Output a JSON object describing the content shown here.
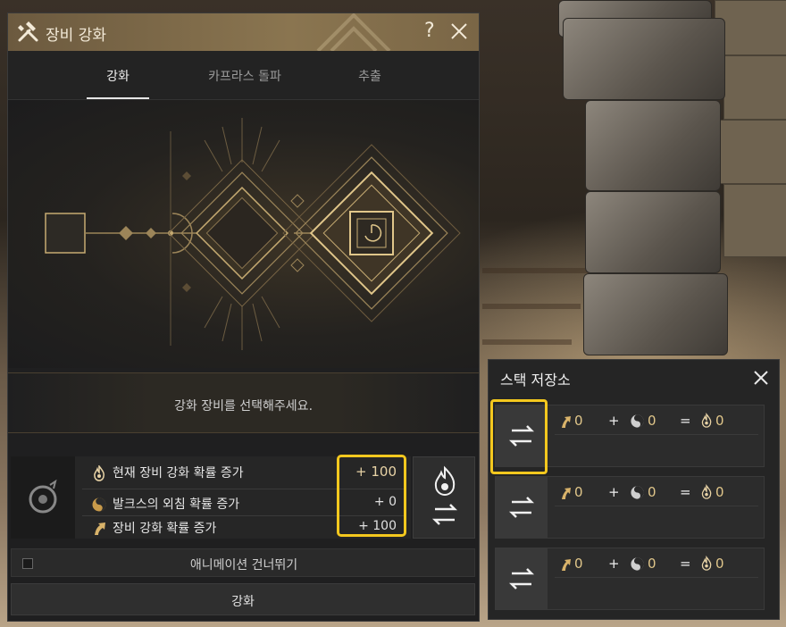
{
  "window": {
    "title": "장비 강화",
    "help_label": "?"
  },
  "tabs": [
    {
      "label": "강화",
      "active": true
    },
    {
      "label": "카프라스 돌파",
      "active": false
    },
    {
      "label": "추출",
      "active": false
    }
  ],
  "stage": {
    "message": "강화 장비를 선택해주세요."
  },
  "rates": {
    "rows": [
      {
        "label": "현재 장비 강화 확률 증가",
        "value": "+ 100",
        "icon": "flame-icon"
      },
      {
        "label": "발크스의 외침 확률 증가",
        "value": "+ 0",
        "icon": "valks-icon"
      },
      {
        "label": "장비 강화 확률 증가",
        "value": "+ 100",
        "icon": "arrow-up-icon"
      }
    ]
  },
  "options": {
    "skip_animation_label": "애니메이션 건너뛰기",
    "skip_animation_checked": false
  },
  "actions": {
    "enhance_label": "강화"
  },
  "stack_storage": {
    "title": "스택 저장소",
    "rows": [
      {
        "a": "0",
        "plus": "+",
        "b": "0",
        "eq": "=",
        "c": "0"
      },
      {
        "a": "0",
        "plus": "+",
        "b": "0",
        "eq": "=",
        "c": "0"
      },
      {
        "a": "0",
        "plus": "+",
        "b": "0",
        "eq": "=",
        "c": "0"
      }
    ]
  },
  "colors": {
    "accent_gold": "#e0c68a",
    "highlight_yellow": "#f4c81e",
    "title_bar": "#7a6646"
  }
}
